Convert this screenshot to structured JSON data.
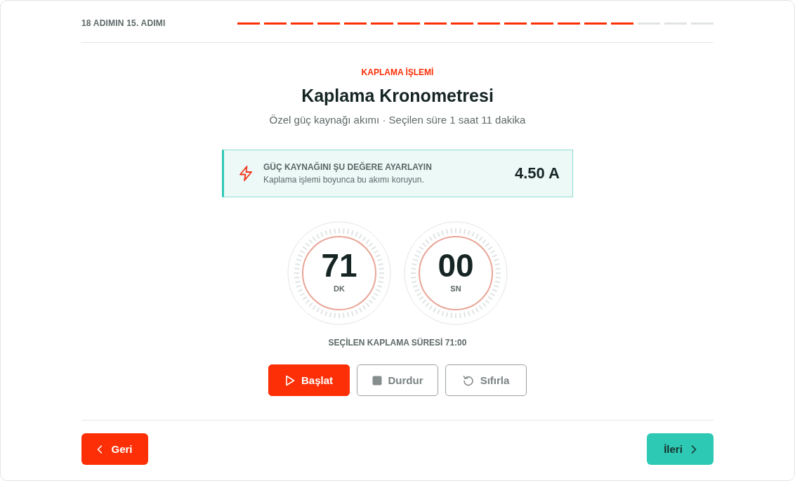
{
  "progress": {
    "label": "18 ADIMIN 15. ADIMI",
    "steps": [
      {
        "done": true
      },
      {
        "done": true
      },
      {
        "done": true
      },
      {
        "done": true
      },
      {
        "done": true
      },
      {
        "done": true
      },
      {
        "done": true
      },
      {
        "done": true
      },
      {
        "done": true
      },
      {
        "done": true
      },
      {
        "done": true
      },
      {
        "done": true
      },
      {
        "done": true
      },
      {
        "done": true
      },
      {
        "done": true
      },
      {
        "done": false
      },
      {
        "done": false
      },
      {
        "done": false
      }
    ]
  },
  "header": {
    "eyebrow": "KAPLAMA İŞLEMİ",
    "title": "Kaplama Kronometresi",
    "subtitle": "Özel güç kaynağı akımı · Seçilen süre 1 saat 11 dakika"
  },
  "instruction": {
    "title": "GÜÇ KAYNAĞINI ŞU DEĞERE AYARLAYIN",
    "text": "Kaplama işlemi boyunca bu akımı koruyun.",
    "value": "4.50 A"
  },
  "timer": {
    "dials": [
      {
        "value": "71",
        "unit": "DK"
      },
      {
        "value": "00",
        "unit": "SN"
      }
    ],
    "summary": "SEÇİLEN KAPLAMA SÜRESİ 71:00"
  },
  "controls": [
    {
      "kind": "play",
      "label": "Başlat",
      "primary": true
    },
    {
      "kind": "stop",
      "label": "Durdur",
      "primary": false
    },
    {
      "kind": "reset",
      "label": "Sıfırla",
      "primary": false
    }
  ],
  "footer": {
    "buttons": [
      {
        "kind": "back",
        "label": "Geri"
      },
      {
        "kind": "next",
        "label": "İleri"
      }
    ]
  }
}
